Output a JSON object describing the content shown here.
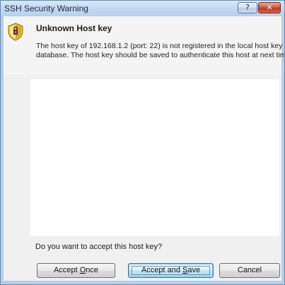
{
  "window": {
    "title": "SSH Security Warning",
    "help_glyph": "?",
    "close_glyph": "✕"
  },
  "dialog": {
    "icon": "security-warning-icon",
    "heading": "Unknown Host key",
    "message_line1": "The host key of 192.168.1.2 (port: 22) is not registered in the local host key",
    "message_line2": "database. The host key should be saved to authenticate this host at next time.",
    "host_key_text": "",
    "question": "Do you want to accept this host key?"
  },
  "buttons": {
    "accept_once": {
      "pre": "Accept ",
      "mnemonic": "O",
      "post": "nce"
    },
    "accept_save": {
      "pre": "Accept and ",
      "mnemonic": "S",
      "post": "ave"
    },
    "cancel": "Cancel"
  },
  "colors": {
    "title_bar": "#c3d9f1",
    "close_button": "#c23a1d",
    "default_button": "#bee6fd"
  }
}
